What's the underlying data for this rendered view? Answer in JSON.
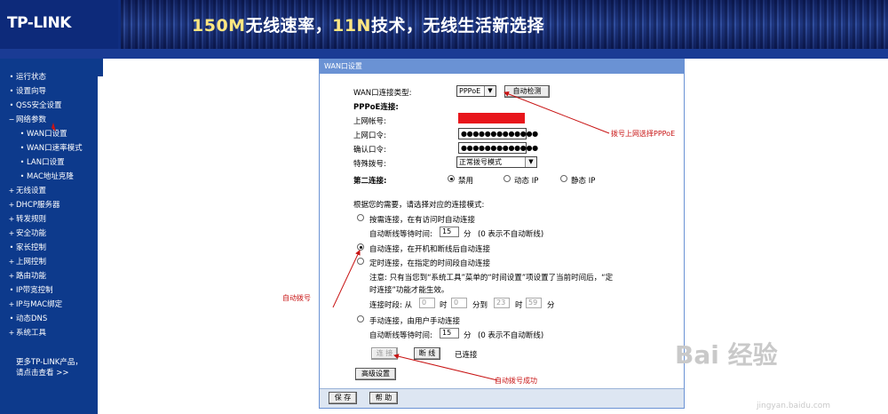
{
  "header": {
    "logo": "TP-LINK",
    "slogan_a": "150M",
    "slogan_b": "无线速率，",
    "slogan_c": "11N",
    "slogan_d": "技术，无线生活新选择"
  },
  "sidebar": {
    "items": [
      {
        "label": "运行状态",
        "bullet": "•"
      },
      {
        "label": "设置向导",
        "bullet": "•"
      },
      {
        "label": "QSS安全设置",
        "bullet": "•"
      },
      {
        "label": "网络参数",
        "bullet": "−"
      },
      {
        "label": "WAN口设置",
        "bullet": "•"
      },
      {
        "label": "WAN口速率模式",
        "bullet": "•"
      },
      {
        "label": "LAN口设置",
        "bullet": "•"
      },
      {
        "label": "MAC地址克隆",
        "bullet": "•"
      },
      {
        "label": "无线设置",
        "bullet": "+"
      },
      {
        "label": "DHCP服务器",
        "bullet": "+"
      },
      {
        "label": "转发规则",
        "bullet": "+"
      },
      {
        "label": "安全功能",
        "bullet": "+"
      },
      {
        "label": "家长控制",
        "bullet": "•"
      },
      {
        "label": "上网控制",
        "bullet": "+"
      },
      {
        "label": "路由功能",
        "bullet": "+"
      },
      {
        "label": "IP带宽控制",
        "bullet": "•"
      },
      {
        "label": "IP与MAC绑定",
        "bullet": "+"
      },
      {
        "label": "动态DNS",
        "bullet": "•"
      },
      {
        "label": "系统工具",
        "bullet": "+"
      }
    ],
    "more_line1": "更多TP-LINK产品，",
    "more_line2": "请点击查看 >>"
  },
  "panel": {
    "title": "WAN口设置",
    "conn_type_label": "WAN口连接类型:",
    "conn_type_value": "PPPoE",
    "auto_detect": "自动检测",
    "pppoe_label": "PPPoE连接:",
    "account_label": "上网帐号:",
    "password_label": "上网口令:",
    "password_value": "●●●●●●●●●●●●●",
    "confirm_label": "确认口令:",
    "confirm_value": "●●●●●●●●●●●●●",
    "dial_label": "特殊拨号:",
    "dial_value": "正常拨号模式",
    "second_label": "第二连接:",
    "second_opt1": "禁用",
    "second_opt2": "动态 IP",
    "second_opt3": "静态 IP",
    "mode_intro": "根据您的需要，请选择对应的连接模式:",
    "mode1": "按需连接，在有访问时自动连接",
    "idle_label": "自动断线等待时间:",
    "idle_value": "15",
    "idle_unit": "分",
    "idle_note": "(0 表示不自动断线)",
    "mode2": "自动连接，在开机和断线后自动连接",
    "mode3": "定时连接，在指定的时间段自动连接",
    "note_line1": "注意: 只有当您到“系统工具”菜单的“时间设置”项设置了当前时间后，“定",
    "note_line2": "时连接”功能才能生效。",
    "period_label": "连接时段: 从",
    "t_h1": "0",
    "t_h_label": "时",
    "t_m1": "0",
    "t_to": "分到",
    "t_h2": "23",
    "t_h2_label": "时",
    "t_m2": "59",
    "t_m2_label": "分",
    "mode4": "手动连接，由用户手动连接",
    "idle2_label": "自动断线等待时间:",
    "idle2_value": "15",
    "idle2_unit": "分",
    "idle2_note": "(0 表示不自动断线)",
    "connect": "连 接",
    "disconnect": "断 线",
    "status": "已连接",
    "advanced": "高级设置",
    "save": "保 存",
    "help": "帮 助"
  },
  "annotations": {
    "a1": "拨号上网选择PPPoE",
    "a2": "自动拨号",
    "a3": "自动拨号成功"
  },
  "watermark": {
    "main": "Bai 经验",
    "sub": "jingyan.baidu.com"
  },
  "colors": {
    "header_bg": "#0f2d80",
    "sidebar_bg": "#0d3a8c",
    "panel_title": "#6a92d4",
    "annotation": "#c81414"
  }
}
